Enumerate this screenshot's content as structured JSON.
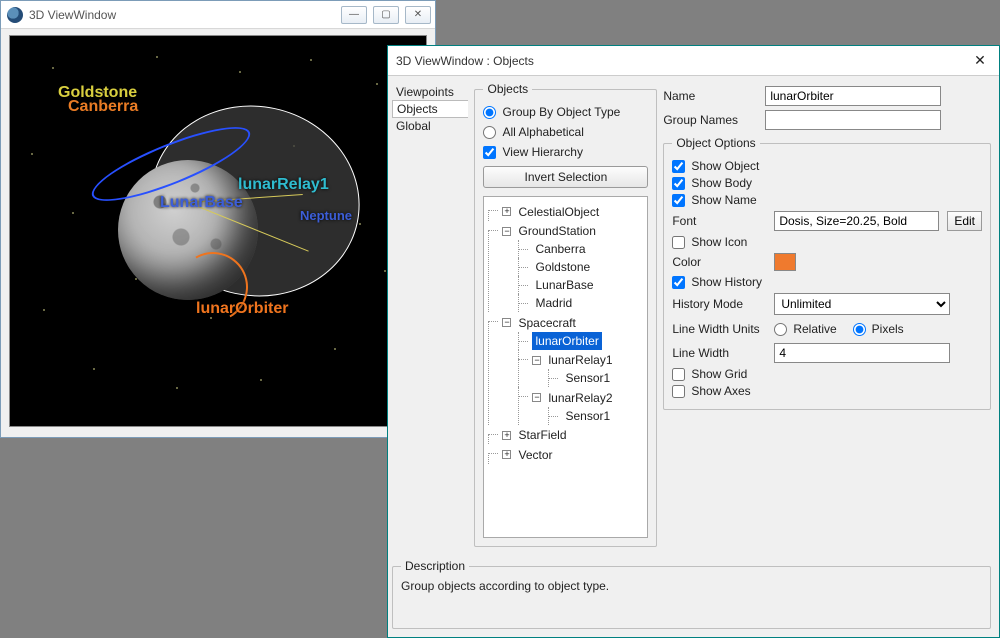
{
  "view_window": {
    "title": "3D ViewWindow",
    "labels": {
      "goldstone": "Goldstone",
      "canberra": "Canberra",
      "lunar_relay": "lunarRelay1",
      "lunar_base": "LunarBase",
      "neptune": "Neptune",
      "lunar_orbiter": "lunarOrbiter"
    }
  },
  "dialog": {
    "title": "3D ViewWindow : Objects",
    "nav": {
      "viewpoints": "Viewpoints",
      "objects": "Objects",
      "global": "Global",
      "selected": "Objects"
    },
    "objects_panel": {
      "legend": "Objects",
      "group_by_type": "Group By Object Type",
      "all_alpha": "All Alphabetical",
      "view_hierarchy": "View Hierarchy",
      "invert": "Invert Selection",
      "tree": {
        "celestial": "CelestialObject",
        "ground_station": "GroundStation",
        "gs_children": {
          "canberra": "Canberra",
          "goldstone": "Goldstone",
          "lunarbase": "LunarBase",
          "madrid": "Madrid"
        },
        "spacecraft": "Spacecraft",
        "sc_children": {
          "lunar_orbiter": "lunarOrbiter",
          "lunar_relay1": "lunarRelay1",
          "lr1_sensor1": "Sensor1",
          "lunar_relay2": "lunarRelay2",
          "lr2_sensor1": "Sensor1"
        },
        "starfield": "StarField",
        "vector": "Vector"
      }
    },
    "details": {
      "name_label": "Name",
      "name_value": "lunarOrbiter",
      "group_names_label": "Group Names",
      "group_names_value": "",
      "options_legend": "Object Options",
      "show_object": "Show Object",
      "show_body": "Show Body",
      "show_name": "Show Name",
      "font_label": "Font",
      "font_value": "Dosis, Size=20.25, Bold",
      "edit": "Edit",
      "show_icon": "Show Icon",
      "color_label": "Color",
      "color_value": "#ef7a2e",
      "show_history": "Show History",
      "history_mode_label": "History Mode",
      "history_mode_value": "Unlimited",
      "line_units_label": "Line Width Units",
      "units_relative": "Relative",
      "units_pixels": "Pixels",
      "line_width_label": "Line Width",
      "line_width_value": "4",
      "show_grid": "Show Grid",
      "show_axes": "Show Axes"
    },
    "description": {
      "legend": "Description",
      "text": "Group objects according to object type."
    }
  }
}
